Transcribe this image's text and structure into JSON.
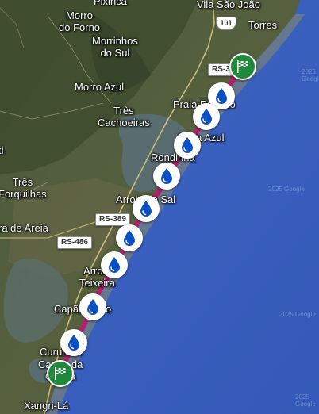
{
  "map": {
    "colors": {
      "ocean": "#3a5fbf",
      "route": "#b31f6e",
      "pin_fill": "#0b4fc4",
      "flag_bg": "#1f8a3b"
    },
    "places": {
      "pixinca": "Pixinca",
      "morro_do_forno": "Morro\ndo Forno",
      "morrinhos_do_sul": "Morrinhos\ndo Sul",
      "vila_sao_joao": "Vila São João",
      "torres": "Torres",
      "morro_azul": "Morro Azul",
      "tres_cachoeiras": "Três\nCachoeiras",
      "praia_paraiso": "Praia Paraíso",
      "praia_azul": "Praia Azul",
      "rondinha": "Rondinha",
      "tres_forquilhas": "Três\nForquilhas",
      "arroio_do_sal": "Arroio do Sal",
      "terra_de_areia": "ra de Areia",
      "arroio_teixeira": "Arroio\nTeixeira",
      "capao_novo": "Capão Novo",
      "curumim": "Curumim",
      "capao_da_canoa": "Capão da\nCanoa",
      "xangri_la": "Xangri-Lá",
      "edge_ti": "ti"
    },
    "roads": {
      "rs389_north": "RS-389",
      "rs389_mid": "RS-389",
      "rs486": "RS-486",
      "br101": "101"
    },
    "markers": [
      {
        "type": "water-drop"
      },
      {
        "type": "water-drop"
      },
      {
        "type": "water-drop"
      },
      {
        "type": "water-drop"
      },
      {
        "type": "water-drop"
      },
      {
        "type": "water-drop"
      },
      {
        "type": "water-drop"
      },
      {
        "type": "water-drop"
      },
      {
        "type": "water-drop"
      }
    ],
    "flags": {
      "start": "checkered-flag",
      "end": "checkered-flag"
    },
    "watermarks": [
      "2025 Google",
      "2025 Google",
      "2025 Google",
      "2025 Google"
    ]
  }
}
